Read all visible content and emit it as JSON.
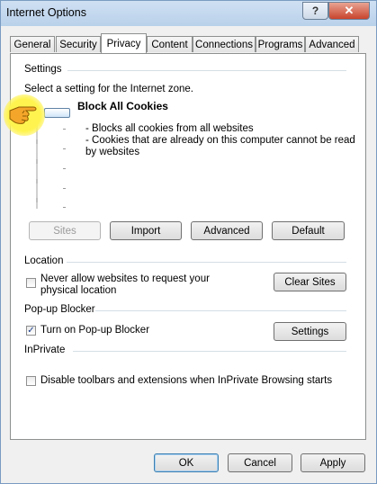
{
  "window": {
    "title": "Internet Options"
  },
  "titlebar": {
    "help_glyph": "?",
    "close_glyph": "✕"
  },
  "tabs": [
    "General",
    "Security",
    "Privacy",
    "Content",
    "Connections",
    "Programs",
    "Advanced"
  ],
  "active_tab": "Privacy",
  "settings": {
    "group_label": "Settings",
    "instruction": "Select a setting for the Internet zone.",
    "level_title": "Block All Cookies",
    "desc_line1": "- Blocks all cookies from all websites",
    "desc_line2": "- Cookies that are already on this computer cannot be read",
    "desc_line3": "by websites",
    "slider_level_fraction": 1.0,
    "buttons": {
      "sites": "Sites",
      "import": "Import",
      "advanced": "Advanced",
      "default": "Default"
    }
  },
  "location": {
    "group_label": "Location",
    "checkbox_label_line1": "Never allow websites to request your",
    "checkbox_label_line2": "physical location",
    "checked": false,
    "clear_sites": "Clear Sites"
  },
  "popup": {
    "group_label": "Pop-up Blocker",
    "checkbox_label": "Turn on Pop-up Blocker",
    "checked": true,
    "check_glyph": "✓",
    "settings_button": "Settings"
  },
  "inprivate": {
    "group_label": "InPrivate",
    "checkbox_label": "Disable toolbars and extensions when InPrivate Browsing starts",
    "checked": false
  },
  "dialog_buttons": {
    "ok": "OK",
    "cancel": "Cancel",
    "apply": "Apply"
  },
  "colors": {
    "highlight": "#fff44f",
    "hand": "#f4a62a"
  },
  "icons": {
    "pointer": "pointing-hand-icon"
  }
}
